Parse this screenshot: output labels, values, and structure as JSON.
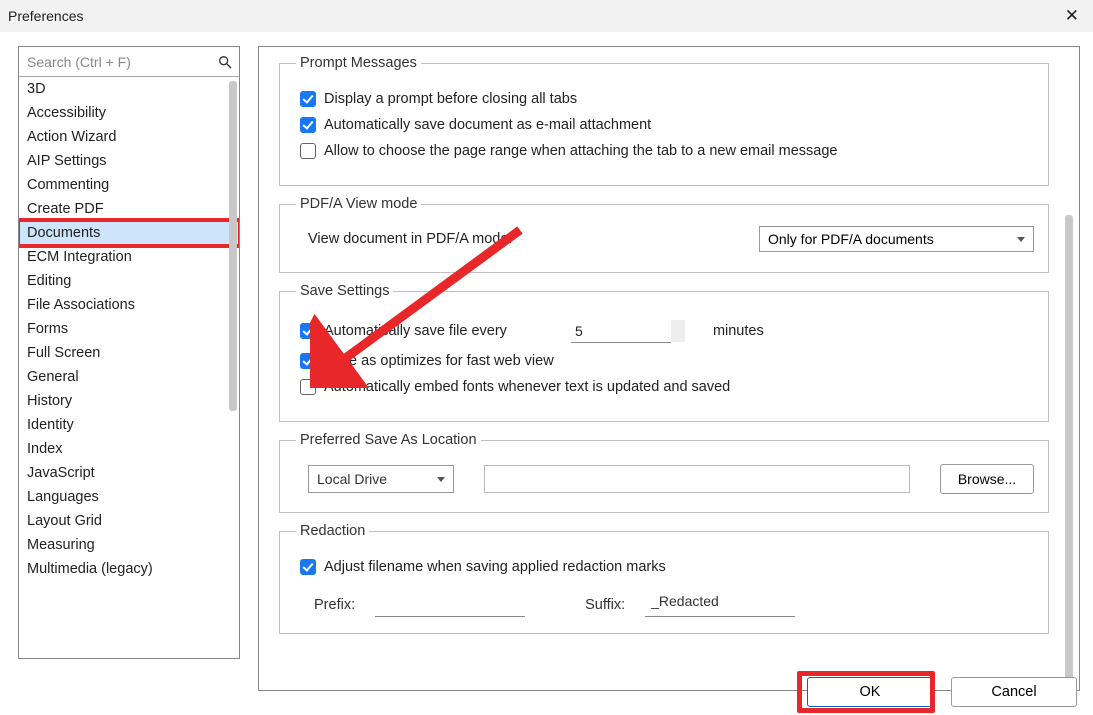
{
  "window": {
    "title": "Preferences"
  },
  "search": {
    "placeholder": "Search (Ctrl + F)"
  },
  "categories": [
    "3D",
    "Accessibility",
    "Action Wizard",
    "AIP Settings",
    "Commenting",
    "Create PDF",
    "Documents",
    "ECM Integration",
    "Editing",
    "File Associations",
    "Forms",
    "Full Screen",
    "General",
    "History",
    "Identity",
    "Index",
    "JavaScript",
    "Languages",
    "Layout Grid",
    "Measuring",
    "Multimedia (legacy)"
  ],
  "selected_category": "Documents",
  "groups": {
    "prompt": {
      "legend": "Prompt Messages",
      "opt1": "Display a prompt before closing all tabs",
      "opt2": "Automatically save document as e-mail attachment",
      "opt3": "Allow to choose the page range when attaching the tab to a new email message"
    },
    "pdfa": {
      "legend": "PDF/A View mode",
      "label": "View document in PDF/A mode:",
      "value": "Only for PDF/A documents"
    },
    "save": {
      "legend": "Save Settings",
      "auto_label": "Automatically save file every",
      "auto_value": "5",
      "auto_unit": "minutes",
      "optimize": "Save as optimizes for fast web view",
      "embed": "Automatically embed fonts whenever text is updated and saved"
    },
    "loc": {
      "legend": "Preferred Save As Location",
      "select_value": "Local Drive",
      "browse": "Browse..."
    },
    "redact": {
      "legend": "Redaction",
      "adjust": "Adjust filename when saving applied redaction marks",
      "prefix_label": "Prefix:",
      "prefix_value": "",
      "suffix_label": "Suffix:",
      "suffix_value": "_Redacted"
    }
  },
  "buttons": {
    "ok": "OK",
    "cancel": "Cancel"
  }
}
